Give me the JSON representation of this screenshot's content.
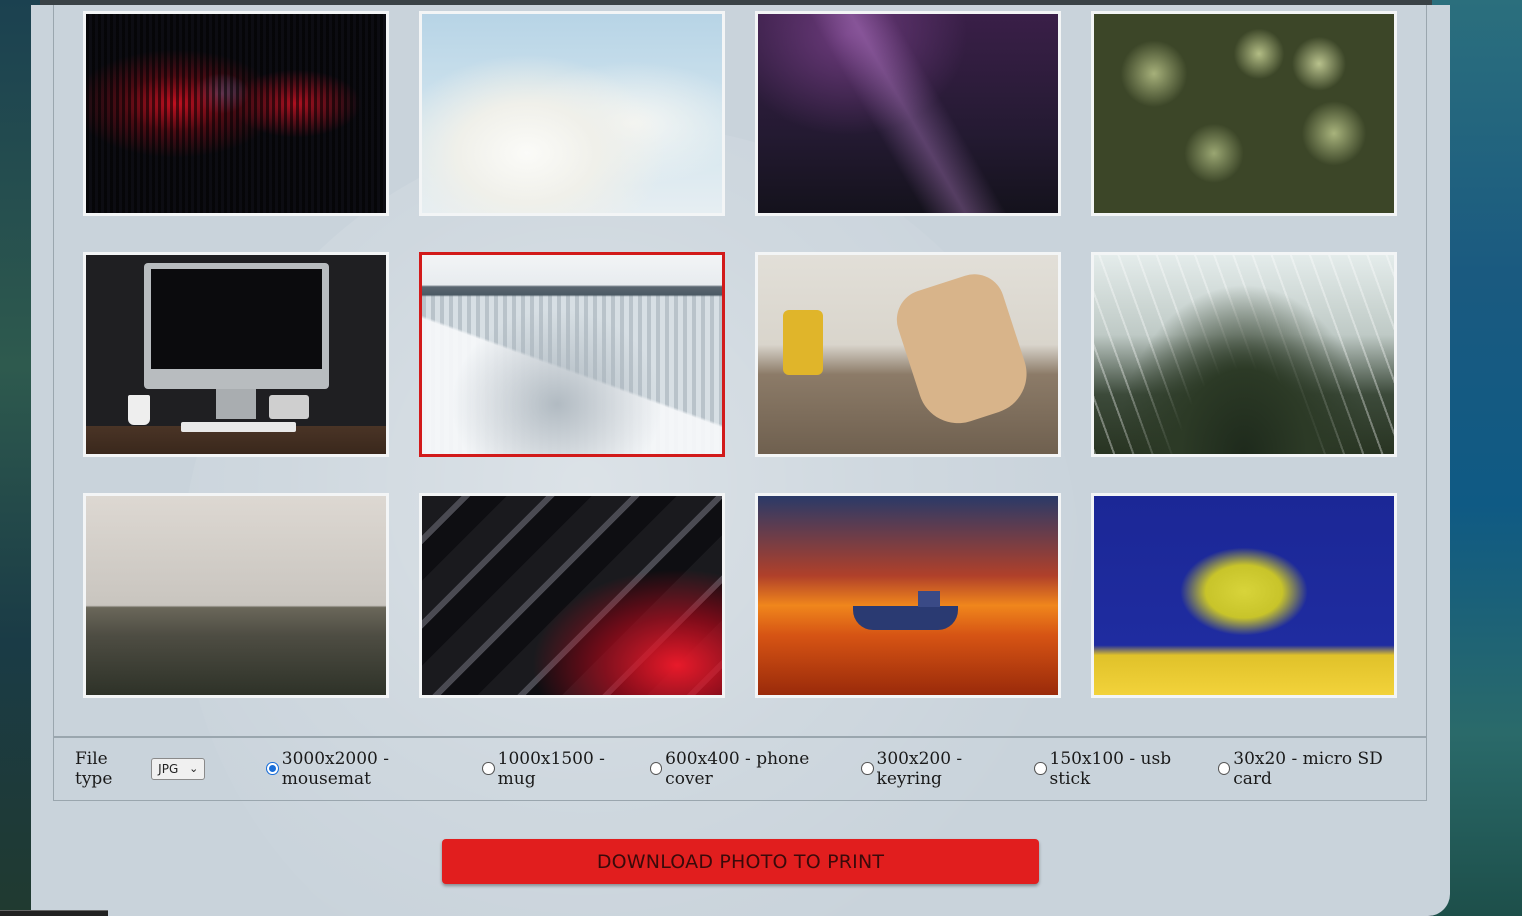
{
  "gallery": {
    "images": [
      {
        "name": "red-blue-neon-blinds-photo",
        "selected": false
      },
      {
        "name": "white-magnolia-blossoms-photo",
        "selected": false
      },
      {
        "name": "purple-skyscrapers-photo",
        "selected": false
      },
      {
        "name": "green-succulent-plants-photo",
        "selected": false
      },
      {
        "name": "desk-computer-setup-photo",
        "selected": false
      },
      {
        "name": "frozen-waterfall-photo",
        "selected": true
      },
      {
        "name": "guitar-workshop-tools-photo",
        "selected": false
      },
      {
        "name": "greenhouse-interior-photo",
        "selected": false
      },
      {
        "name": "misty-coastline-photo",
        "selected": false
      },
      {
        "name": "abstract-red-chrome-photo",
        "selected": false
      },
      {
        "name": "boat-sunset-photo",
        "selected": false
      },
      {
        "name": "yellow-tree-blue-sky-photo",
        "selected": false
      }
    ]
  },
  "options": {
    "file_type_label": "File type",
    "file_type_value": "JPG",
    "sizes": [
      {
        "label": "3000x2000 - mousemat",
        "checked": true
      },
      {
        "label": "1000x1500 - mug",
        "checked": false
      },
      {
        "label": "600x400 - phone cover",
        "checked": false
      },
      {
        "label": "300x200 - keyring",
        "checked": false
      },
      {
        "label": "150x100 - usb stick",
        "checked": false
      },
      {
        "label": "30x20 - micro SD card",
        "checked": false
      }
    ]
  },
  "download_button": "DOWNLOAD PHOTO TO PRINT",
  "colors": {
    "accent_red": "#e11e1e",
    "selected_border": "#d21a1a",
    "radio_checked": "#1a6ed8",
    "panel_bg": "#c9d3db"
  }
}
